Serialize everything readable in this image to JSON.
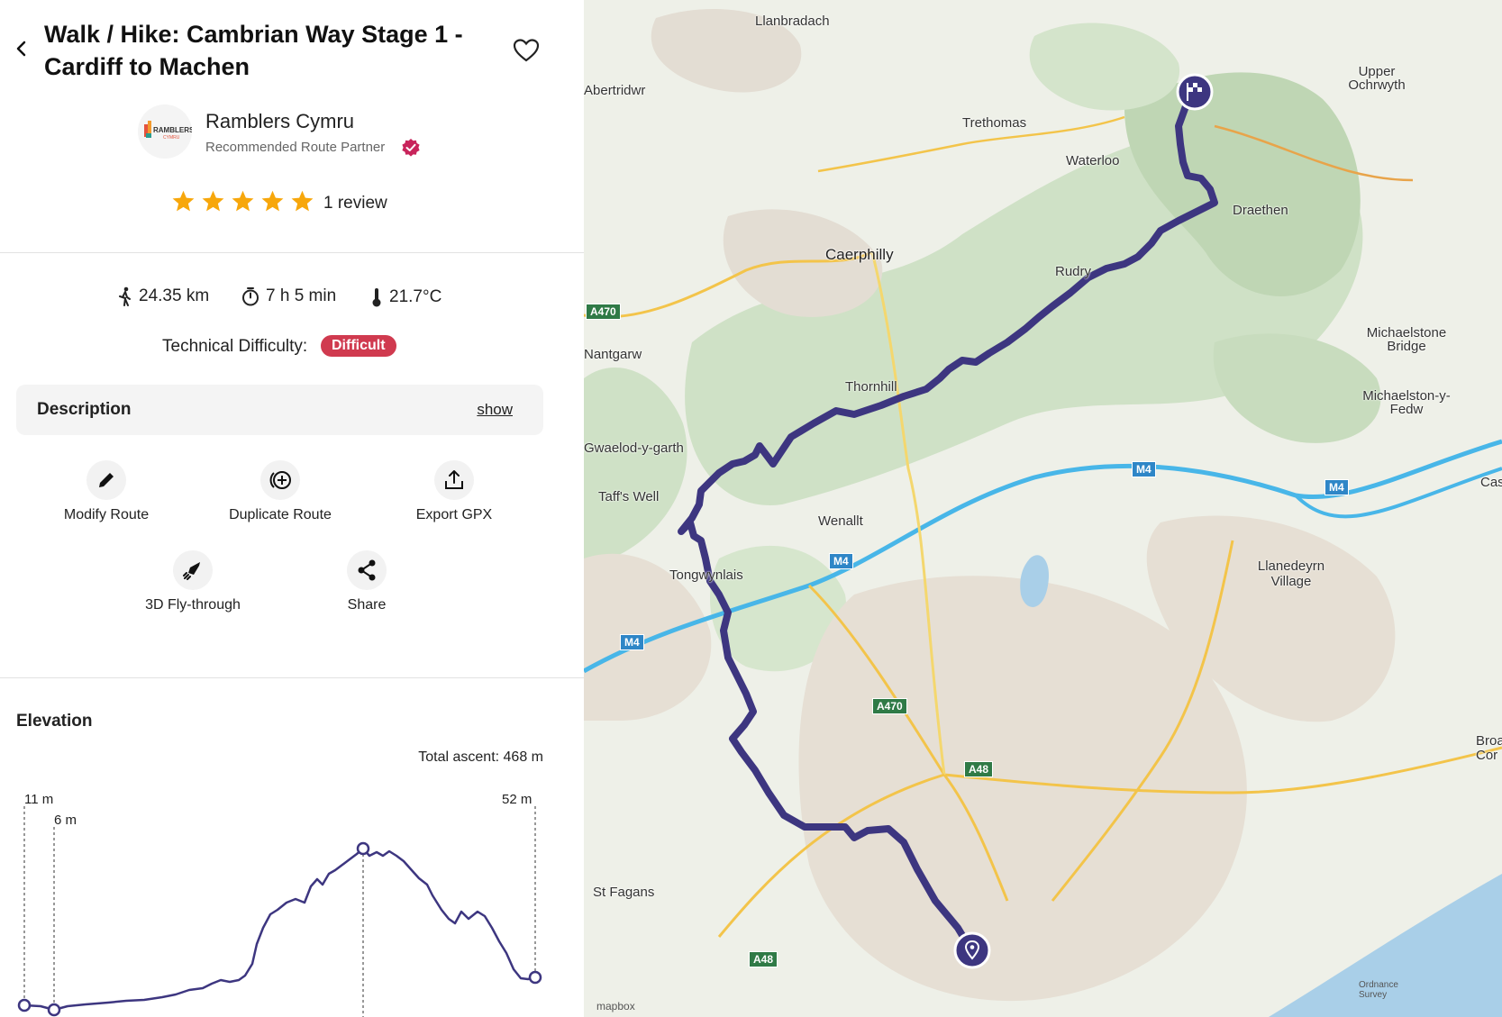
{
  "header": {
    "back_label": "back",
    "title": "Walk / Hike: Cambrian Way Stage 1 - Cardiff to Machen"
  },
  "author": {
    "logo_text": "RAMBLERS",
    "logo_sub": "CYMRU",
    "name": "Ramblers Cymru",
    "badge": "Recommended Route Partner"
  },
  "rating": {
    "stars": 5,
    "review_text": "1 review"
  },
  "stats": {
    "distance": "24.35 km",
    "duration": "7 h 5 min",
    "temperature": "21.7°C"
  },
  "difficulty": {
    "label": "Technical Difficulty:",
    "value": "Difficult",
    "color": "#d03a4f"
  },
  "description": {
    "title": "Description",
    "show_label": "show"
  },
  "actions": [
    {
      "label": "Modify Route",
      "icon": "pencil-icon"
    },
    {
      "label": "Duplicate Route",
      "icon": "duplicate-icon"
    },
    {
      "label": "Export GPX",
      "icon": "export-icon"
    },
    {
      "label": "3D Fly-through",
      "icon": "rocket-icon"
    },
    {
      "label": "Share",
      "icon": "share-icon"
    }
  ],
  "elevation": {
    "title": "Elevation",
    "total_ascent": "Total ascent: 468 m",
    "markers": [
      "11 m",
      "6 m",
      "52 m"
    ],
    "accent": "#3d3680"
  },
  "map": {
    "labels": {
      "llanbradach": "Llanbradach",
      "abertridwr": "Abertridwr",
      "trethomas": "Trethomas",
      "waterloo": "Waterloo",
      "upper_ochrwyth": "Upper Ochrwyth",
      "draethen": "Draethen",
      "caerphilly": "Caerphilly",
      "rudry": "Rudry",
      "nantgarw": "Nantgarw",
      "michaelstone_bridge": "Michaelstone Bridge",
      "thornhill": "Thornhill",
      "michaelston_fedw": "Michaelston-y-Fedw",
      "pentyrch": "Gwaelod-y-garth",
      "taffs_well": "Taff's Well",
      "wenallt": "Wenallt",
      "cas": "Cas",
      "tongwynlais": "Tongwynlais",
      "llanedeyrn": "Llanedeyrn Village",
      "broad": "Broad Cor",
      "st_fagans": "St Fagans"
    },
    "roads": {
      "a470_a": "A470",
      "a470_b": "A470",
      "a48_a": "A48",
      "a48_b": "A48",
      "m4_a": "M4",
      "m4_b": "M4",
      "m4_c": "M4",
      "m4_d": "M4"
    },
    "route_color": "#3d3680",
    "attribution_mapbox": "mapbox",
    "attribution_os": "Ordnance Survey"
  }
}
